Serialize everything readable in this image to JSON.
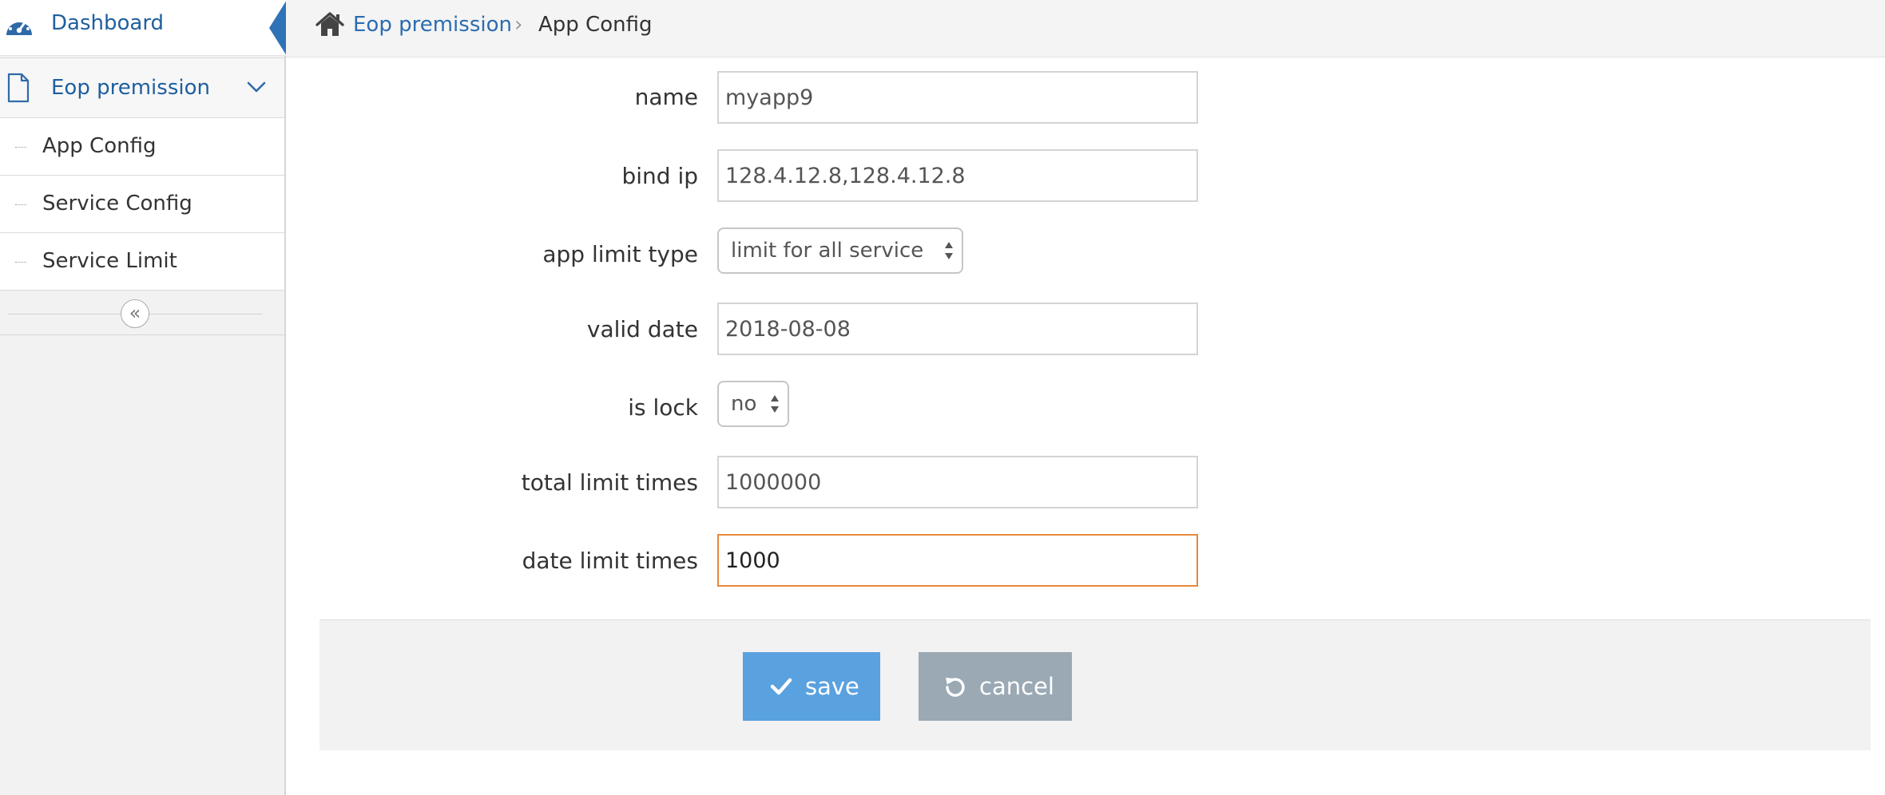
{
  "sidebar": {
    "dashboard_label": "Dashboard",
    "group_label": "Eop premission",
    "items": [
      {
        "label": "App Config"
      },
      {
        "label": "Service Config"
      },
      {
        "label": "Service Limit"
      }
    ],
    "collapse_glyph": "«"
  },
  "breadcrumb": {
    "parent": "Eop premission",
    "separator": "›",
    "current": "App Config"
  },
  "form": {
    "name": {
      "label": "name",
      "value": "myapp9"
    },
    "bind_ip": {
      "label": "bind ip",
      "value": "128.4.12.8,128.4.12.8"
    },
    "app_limit_type": {
      "label": "app limit type",
      "selected": "limit for all service"
    },
    "valid_date": {
      "label": "valid date",
      "value": "2018-08-08"
    },
    "is_lock": {
      "label": "is lock",
      "selected": "no"
    },
    "total_limit_times": {
      "label": "total limit times",
      "value": "1000000"
    },
    "date_limit_times": {
      "label": "date limit times",
      "value": "1000"
    }
  },
  "actions": {
    "save_label": "save",
    "cancel_label": "cancel"
  },
  "icons": {
    "dashboard": "dashboard-gauge-icon",
    "group": "document-icon",
    "expand": "chevron-down-icon",
    "home": "home-icon",
    "save": "check-icon",
    "cancel": "undo-icon",
    "collapse": "double-chevron-left-icon"
  },
  "colors": {
    "link_blue": "#1f5f9e",
    "active_marker": "#2f73b7",
    "focus_border": "#e8883a",
    "save_button": "#5aa1df",
    "cancel_button": "#9aa9b4"
  }
}
